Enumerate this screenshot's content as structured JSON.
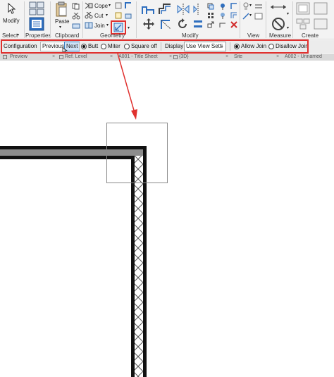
{
  "ribbon": {
    "modify_label": "Modify",
    "paste_label": "Paste",
    "cope_label": "Cope",
    "cut_label": "Cut",
    "join_label": "Join",
    "panels": {
      "select": "Select",
      "properties": "Properties",
      "clipboard": "Clipboard",
      "geometry": "Geometry",
      "modify": "Modify",
      "view": "View",
      "measure": "Measure",
      "create": "Create"
    },
    "accent_color": "#3c7fc1"
  },
  "options_bar": {
    "configuration_label": "Configuration",
    "previous_label": "Previous",
    "next_label": "Next",
    "butt_label": "Butt",
    "miter_label": "Miter",
    "square_off_label": "Square off",
    "display_label": "Display",
    "display_value": "Use View Setti",
    "allow_join_label": "Allow Join",
    "disallow_join_label": "Disallow Join",
    "selected_radio": "Butt",
    "selected_join": "Allow Join"
  },
  "tabs": [
    {
      "label": "Preview"
    },
    {
      "label": "Ref. Level"
    },
    {
      "label": "A001 - Title Sheet"
    },
    {
      "label": "{3D}"
    },
    {
      "label": "Site"
    },
    {
      "label": "A002 - Unnamed"
    }
  ],
  "annotation": {
    "highlight_color": "#e0312f"
  }
}
